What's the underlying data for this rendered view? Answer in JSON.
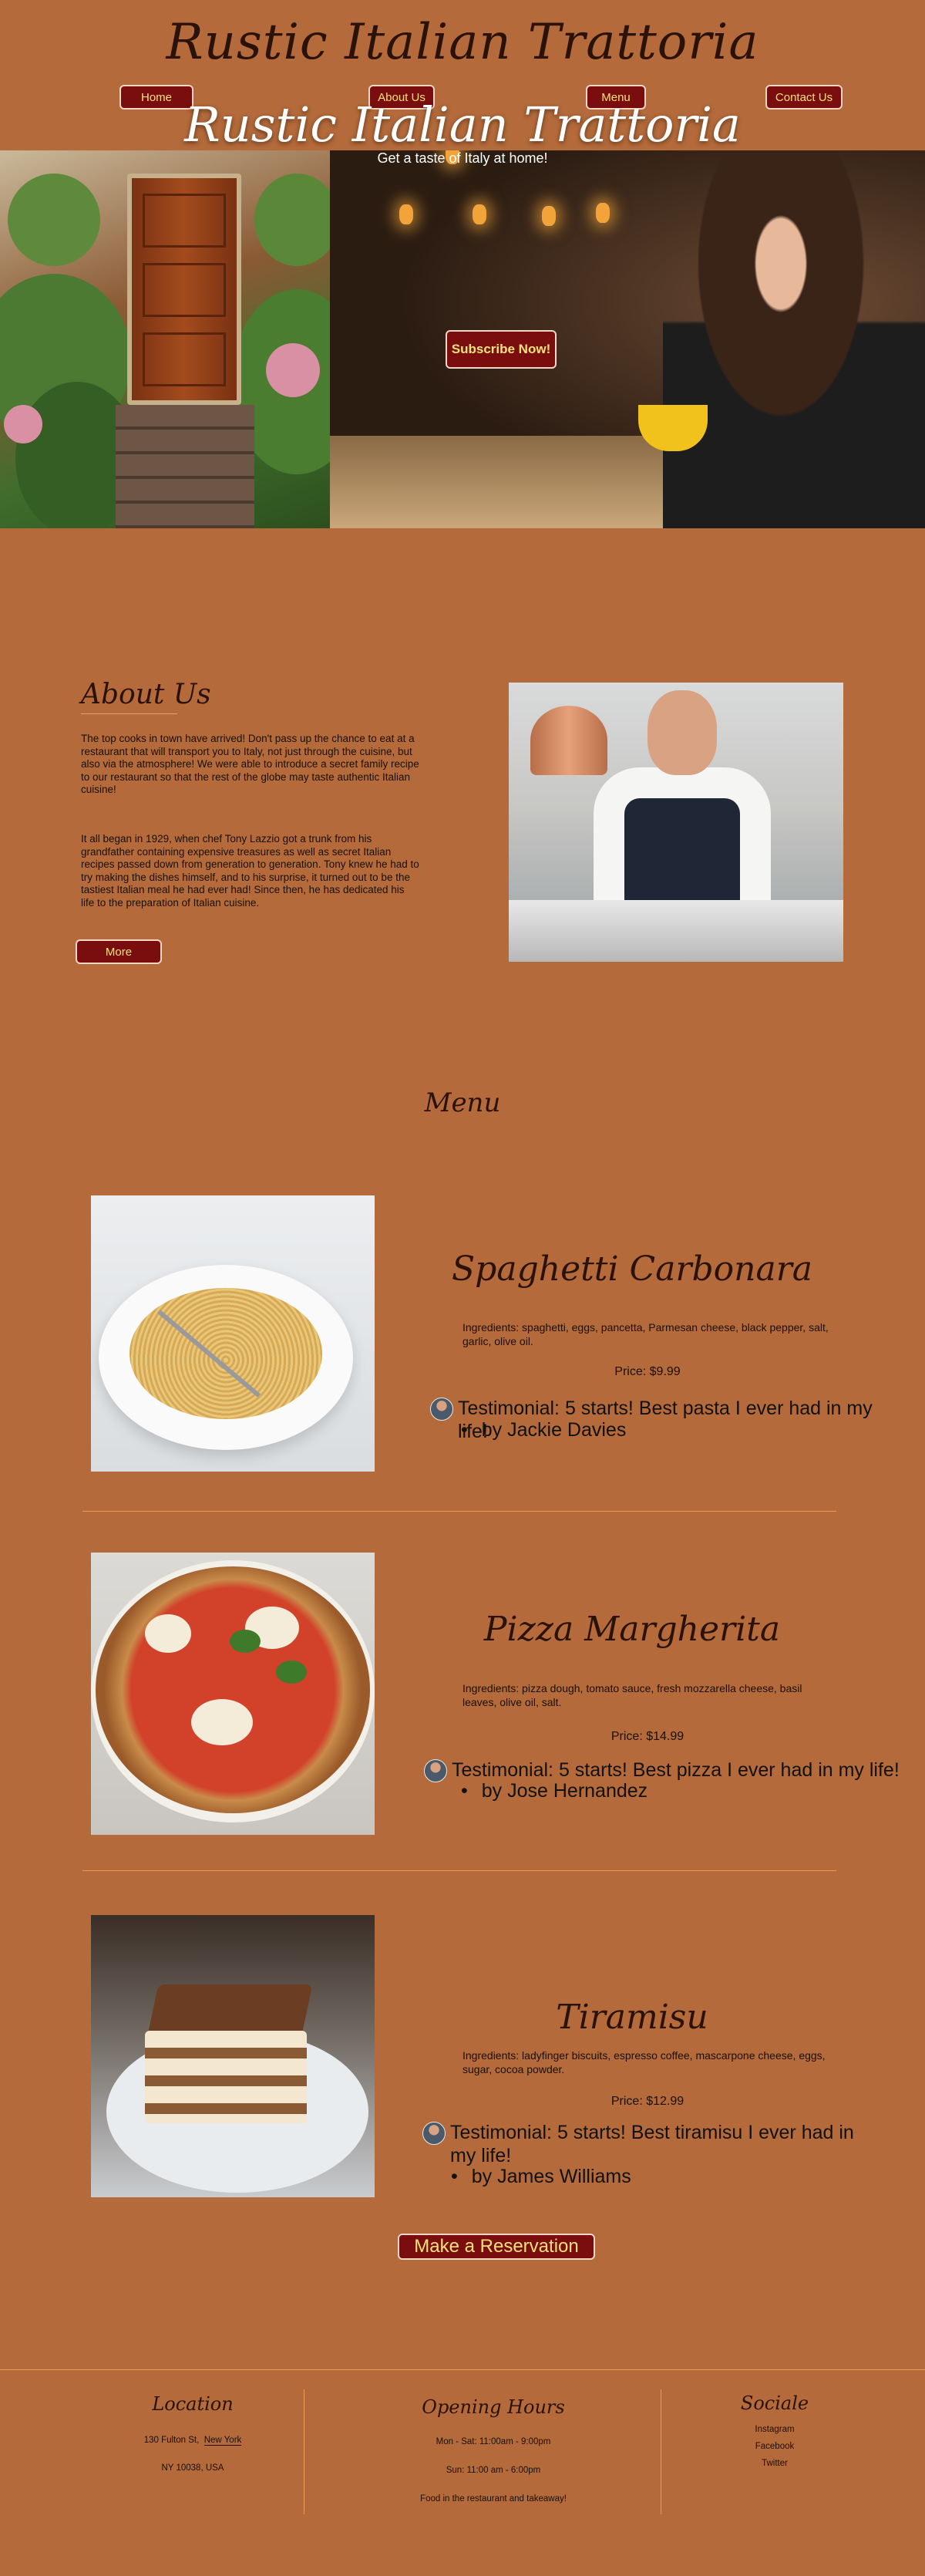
{
  "brand": "Rustic Italian Trattoria",
  "nav": [
    "Home",
    "About Us",
    "Menu",
    "Contact Us"
  ],
  "hero": {
    "title": "Rustic Italian Trattoria",
    "subtitle": "Get a taste of Italy at home!",
    "cta": "Subscribe Now!"
  },
  "about": {
    "title": "About Us",
    "p1": "The top cooks in town have arrived! Don't pass up the chance to eat at a restaurant that will transport you to Italy, not just through the cuisine, but also via the atmosphere! We were able to introduce a secret family recipe to our restaurant so that the rest of the globe may taste authentic Italian cuisine!",
    "p2": "It all began in 1929, when chef Tony Lazzio got a trunk from his grandfather containing expensive treasures as well as secret Italian recipes passed down from generation to generation. Tony knew he had to try making the dishes himself, and to his surprise, it turned out to be the tastiest Italian meal he had ever had! Since then, he has dedicated his life to the preparation of Italian cuisine.",
    "button": "More"
  },
  "menu": {
    "title": "Menu",
    "dishes": [
      {
        "name": "Spaghetti Carbonara",
        "ingredients": "Ingredients: spaghetti, eggs, pancetta, Parmesan cheese, black pepper, salt, garlic, olive oil.",
        "price": "Price: $9.99",
        "testimonial": "Testimonial: 5 starts! Best pasta I ever had in my life!",
        "author": "by Jackie Davies"
      },
      {
        "name": "Pizza Margherita",
        "ingredients": "Ingredients: pizza dough, tomato sauce, fresh mozzarella cheese, basil leaves, olive oil, salt.",
        "price": "Price: $14.99",
        "testimonial": "Testimonial: 5 starts! Best pizza I ever had in my life!",
        "author": "by Jose Hernandez"
      },
      {
        "name": "Tiramisu",
        "ingredients": "Ingredients: ladyfinger biscuits, espresso coffee, mascarpone cheese, eggs, sugar, cocoa powder.",
        "price": "Price: $12.99",
        "testimonial": "Testimonial: 5 starts! Best tiramisu I ever had in my life!",
        "author": "by James Williams"
      }
    ]
  },
  "reservation": "Make a Reservation",
  "footer": {
    "location": {
      "title": "Location",
      "line1": "130 Fulton St,",
      "line1b": "New York",
      "line2": "NY 10038, USA"
    },
    "hours": {
      "title": "Opening Hours",
      "line1": "Mon - Sat: 11:00am - 9:00pm",
      "line2": "Sun: 11:00 am - 6:00pm",
      "line3": "Food in the restaurant and takeaway!"
    },
    "socials": {
      "title": "Sociale",
      "links": [
        "Instagram",
        "Facebook",
        "Twitter"
      ]
    }
  },
  "colors": {
    "background": "#b46a3a",
    "button": "#7a0d0d",
    "button_text": "#f7e27a",
    "divider": "#ee9a55"
  }
}
